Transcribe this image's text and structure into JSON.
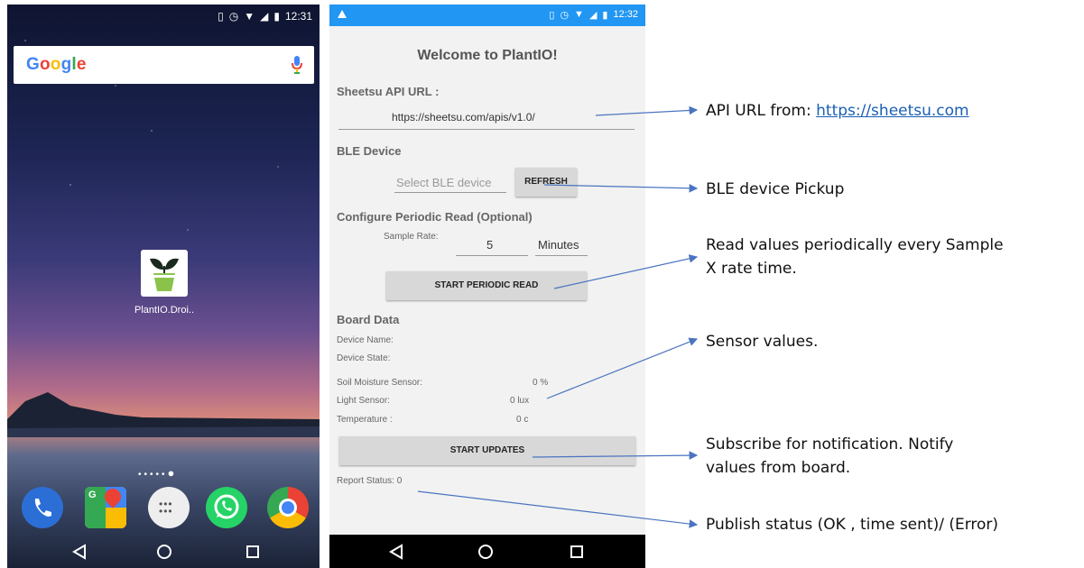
{
  "home": {
    "status_time": "12:31",
    "search_logo": "Google",
    "app_label": "PlantIO.Droi..",
    "dock_apps": [
      "phone-icon",
      "maps-icon",
      "app-drawer-icon",
      "whatsapp-icon",
      "chrome-icon"
    ]
  },
  "app": {
    "status_time": "12:32",
    "title": "Welcome to PlantIO!",
    "api_section": "Sheetsu API URL :",
    "api_value": "https://sheetsu.com/apis/v1.0/",
    "ble_section": "BLE Device",
    "ble_placeholder": "Select BLE device",
    "refresh_label": "REFRESH",
    "periodic_section": "Configure Periodic Read (Optional)",
    "sample_rate_label": "Sample Rate:",
    "sample_rate_value": "5",
    "sample_rate_unit": "Minutes",
    "start_periodic_label": "START PERIODIC READ",
    "board_section": "Board Data",
    "device_name_label": "Device Name:",
    "device_state_label": "Device State:",
    "soil_label": "Soil Moisture Sensor:",
    "soil_value": "0 %",
    "light_label": "Light Sensor:",
    "light_value": "0 lux",
    "temp_label": "Temperature :",
    "temp_value": "0 c",
    "start_updates_label": "START UPDATES",
    "report_status": "Report Status: 0"
  },
  "annotations": {
    "api_prefix": "API URL from: ",
    "api_link": "https://sheetsu.com",
    "ble": "BLE device Pickup",
    "read_line1": "Read values periodically every Sample",
    "read_line2": "X rate time.",
    "sensor": "Sensor values.",
    "subscribe_line1": "Subscribe for notification. Notify",
    "subscribe_line2": "values from board.",
    "publish": "Publish status (OK , time sent)/ (Error)"
  },
  "colors": {
    "app_status_bar": "#2196f3",
    "arrow": "#4a74c0",
    "link": "#1a5fb4"
  }
}
